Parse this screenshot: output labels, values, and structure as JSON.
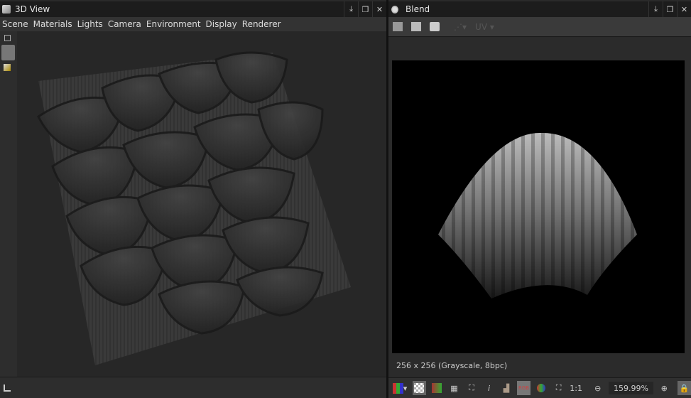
{
  "left_panel": {
    "title": "3D View",
    "menu": [
      "Scene",
      "Materials",
      "Lights",
      "Camera",
      "Environment",
      "Display",
      "Renderer"
    ]
  },
  "right_panel": {
    "title": "Blend",
    "toolbar": {
      "uv_label": "UV"
    },
    "status": "256 x 256 (Grayscale, 8bpc)",
    "bottom": {
      "ratio_label": "1:1",
      "zoom": "159.99%",
      "rgb_label": "RGB",
      "info_label": "i"
    }
  }
}
